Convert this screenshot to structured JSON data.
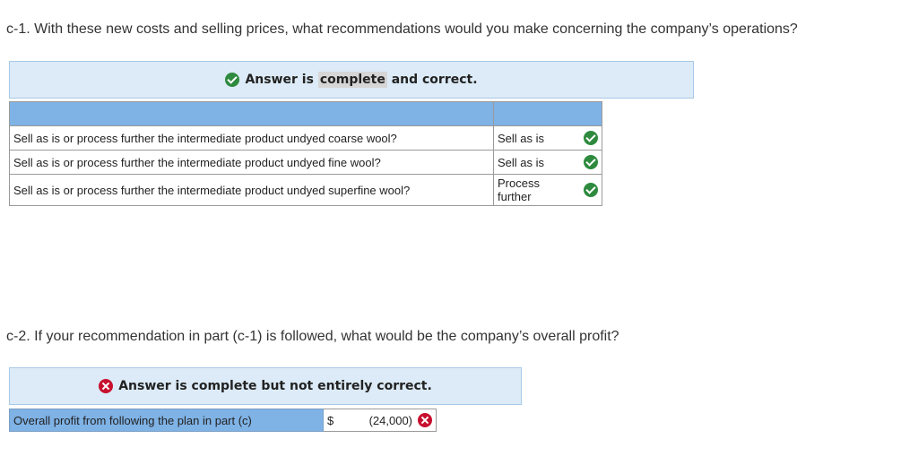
{
  "question1": "c-1. With these new costs and selling prices, what recommendations would you make concerning the company’s operations?",
  "banner1": {
    "pre": "Answer is ",
    "highlight": "complete",
    "post": " and correct.",
    "icon": "check-circle-icon"
  },
  "table1": {
    "rows": [
      {
        "question": "Sell as is or process further the intermediate product undyed coarse wool?",
        "answer": "Sell as is",
        "status": "correct"
      },
      {
        "question": "Sell as is or process further the intermediate product undyed fine wool?",
        "answer": "Sell as is",
        "status": "correct"
      },
      {
        "question": "Sell as is or process further the intermediate product undyed superfine wool?",
        "answer_line1": "Process",
        "answer_line2": "further",
        "status": "correct"
      }
    ]
  },
  "question2": "c-2. If your recommendation in part (c-1) is followed, what would be the company’s overall profit?",
  "banner2": {
    "text": "Answer is complete but not entirely correct.",
    "icon": "x-circle-icon"
  },
  "profit": {
    "label": "Overall profit from following the plan in part (c)",
    "currency": "$",
    "value": "(24,000)",
    "status": "incorrect"
  },
  "colors": {
    "header_blue": "#7fb2e5",
    "banner_bg": "#dcebf7",
    "correct_green": "#2e8a3e",
    "incorrect_red": "#c8102e"
  }
}
